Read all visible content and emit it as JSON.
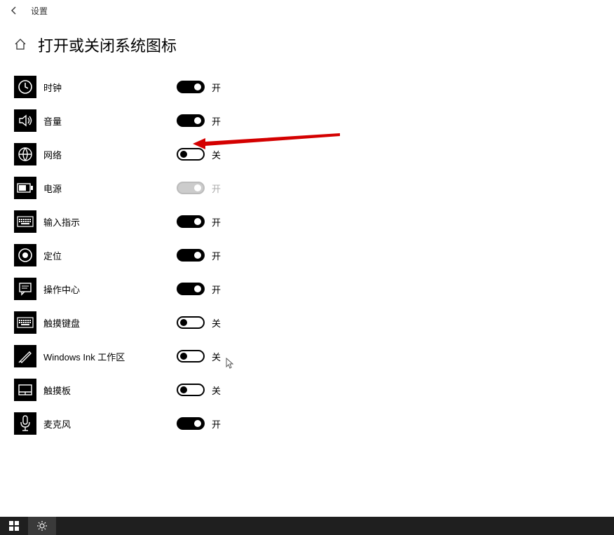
{
  "titlebar": {
    "app_title": "设置"
  },
  "header": {
    "page_title": "打开或关闭系统图标"
  },
  "labels": {
    "on": "开",
    "off": "关"
  },
  "items": [
    {
      "id": "clock",
      "label": "时钟",
      "state": "on",
      "disabled": false
    },
    {
      "id": "volume",
      "label": "音量",
      "state": "on",
      "disabled": false
    },
    {
      "id": "network",
      "label": "网络",
      "state": "off",
      "disabled": false
    },
    {
      "id": "power",
      "label": "电源",
      "state": "on",
      "disabled": true
    },
    {
      "id": "input-indicator",
      "label": "输入指示",
      "state": "on",
      "disabled": false
    },
    {
      "id": "location",
      "label": "定位",
      "state": "on",
      "disabled": false
    },
    {
      "id": "action-center",
      "label": "操作中心",
      "state": "on",
      "disabled": false
    },
    {
      "id": "touch-keyboard",
      "label": "触摸键盘",
      "state": "off",
      "disabled": false
    },
    {
      "id": "windows-ink",
      "label": "Windows Ink 工作区",
      "state": "off",
      "disabled": false
    },
    {
      "id": "touchpad",
      "label": "触摸板",
      "state": "off",
      "disabled": false
    },
    {
      "id": "microphone",
      "label": "麦克风",
      "state": "on",
      "disabled": false
    }
  ],
  "annotation": {
    "arrow_color": "#d40000",
    "target": "network-toggle"
  }
}
